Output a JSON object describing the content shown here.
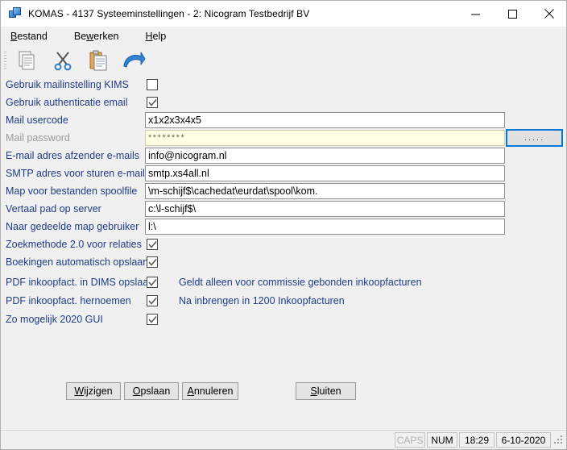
{
  "window": {
    "title": "KOMAS - 4137 Systeeminstellingen - 2: Nicogram Testbedrijf BV",
    "app_icon": "windows-stack-icon",
    "minimize_label": "Minimaliseren",
    "maximize_label": "Maximaliseren",
    "close_label": "Sluiten"
  },
  "menubar": {
    "items": [
      {
        "label": "Bestand",
        "accel": "B"
      },
      {
        "label": "Bewerken",
        "accel": "w"
      },
      {
        "label": "Help",
        "accel": "H"
      }
    ]
  },
  "toolbar": {
    "buttons": [
      {
        "name": "copy-icon",
        "tooltip": "Kopieren"
      },
      {
        "name": "cut-icon",
        "tooltip": "Knippen"
      },
      {
        "name": "paste-icon",
        "tooltip": "Plakken"
      },
      {
        "name": "redo-arrow-icon",
        "tooltip": "Opnieuw"
      }
    ]
  },
  "form": {
    "rows": [
      {
        "label": "Gebruik mailinstelling KIMS",
        "type": "checkbox",
        "checked": false
      },
      {
        "label": "Gebruik authenticatie email",
        "type": "checkbox",
        "checked": true
      },
      {
        "label": "Mail usercode",
        "type": "text",
        "value": "x1x2x3x4x5"
      },
      {
        "label": "Mail password",
        "type": "password",
        "value": "********",
        "disabled": true
      },
      {
        "label": "E-mail adres afzender e-mails",
        "type": "text",
        "value": "info@nicogram.nl"
      },
      {
        "label": "SMTP adres voor sturen e-mails",
        "type": "text",
        "value": "smtp.xs4all.nl"
      },
      {
        "label": "Map voor bestanden spoolfile",
        "type": "text",
        "value": "\\m-schijf$\\cachedat\\eurdat\\spool\\kom."
      },
      {
        "label": "Vertaal pad op server",
        "type": "text",
        "value": "c:\\l-schijf$\\"
      },
      {
        "label": "Naar gedeelde map gebruiker",
        "type": "text",
        "value": "l:\\"
      },
      {
        "label": "Zoekmethode 2.0 voor relaties",
        "type": "checkbox",
        "checked": true
      },
      {
        "label": "Boekingen automatisch opslaan",
        "type": "checkbox",
        "checked": true
      },
      {
        "label": "PDF inkoopfact. in DIMS opslaan",
        "type": "checkbox",
        "checked": true,
        "hint": "Geldt alleen voor commissie gebonden inkoopfacturen"
      },
      {
        "label": "PDF inkoopfact. hernoemen",
        "type": "checkbox",
        "checked": true,
        "hint": "Na inbrengen in 1200 Inkoopfacturen"
      },
      {
        "label": "Zo mogelijk 2020 GUI",
        "type": "checkbox",
        "checked": true
      }
    ],
    "browse_button_label": "....."
  },
  "buttons": [
    {
      "label": "Wijzigen",
      "accel": "W"
    },
    {
      "label": "Opslaan",
      "accel": "O"
    },
    {
      "label": "Annuleren",
      "accel": "A"
    },
    {
      "label": "Sluiten",
      "accel": "S"
    }
  ],
  "statusbar": {
    "caps": "CAPS",
    "caps_active": false,
    "num": "NUM",
    "num_active": true,
    "time": "18:29",
    "date": "6-10-2020"
  },
  "colors": {
    "label_blue": "#1f3c88",
    "window_bg": "#f0f0f0",
    "focus_blue": "#0078d7",
    "password_bg": "#ffffe4"
  }
}
